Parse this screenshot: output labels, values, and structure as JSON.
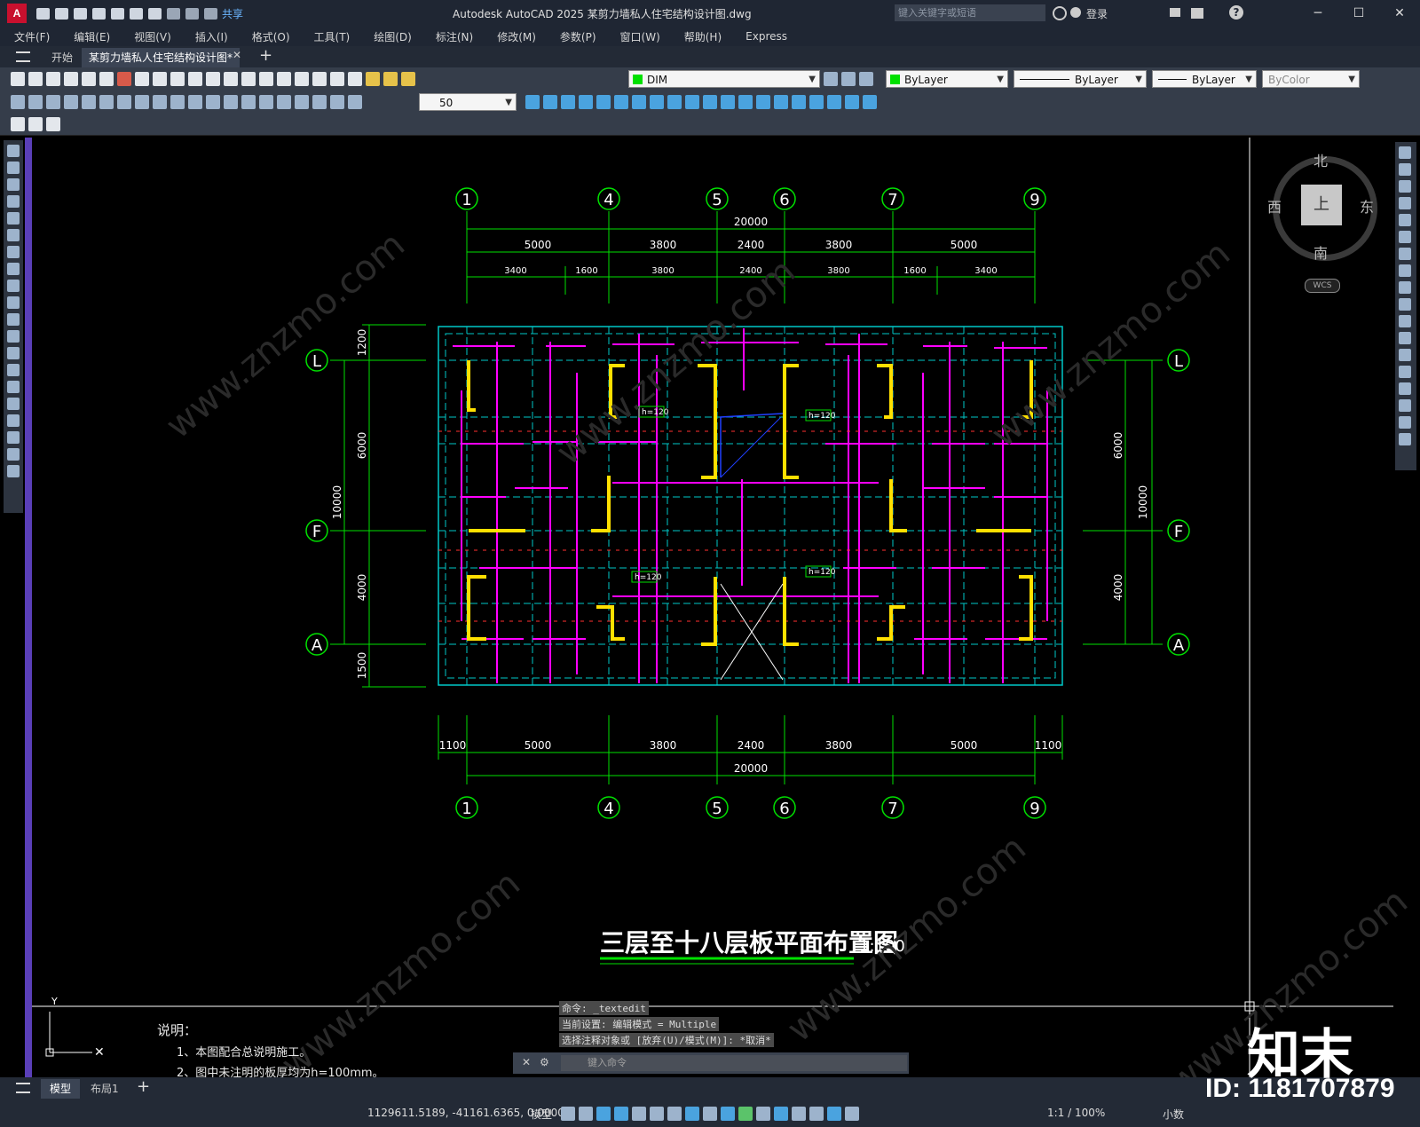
{
  "app": {
    "title": "Autodesk AutoCAD 2025    某剪力墙私人住宅结构设计图.dwg",
    "logo": "A",
    "share_label": "共享",
    "search_placeholder": "键入关键字或短语",
    "login_label": "登录",
    "help_label": "?"
  },
  "menu": [
    "文件(F)",
    "编辑(E)",
    "视图(V)",
    "插入(I)",
    "格式(O)",
    "工具(T)",
    "绘图(D)",
    "标注(N)",
    "修改(M)",
    "参数(P)",
    "窗口(W)",
    "帮助(H)",
    "Express"
  ],
  "tabs": {
    "start": "开始",
    "active": "某剪力墙私人住宅结构设计图*",
    "add": "+"
  },
  "toolbar": {
    "layer": "DIM",
    "color": "ByLayer",
    "linetype": "ByLayer",
    "lineweight": "ByLayer",
    "plotstyle": "ByColor",
    "dim_scale": "50"
  },
  "viewcube": {
    "north": "北",
    "south": "南",
    "east": "东",
    "west": "西",
    "face": "上",
    "wcs": "WCS"
  },
  "drawing": {
    "title": "三层至十八层板平面布置图",
    "scale": "1:100",
    "grid_top": [
      "1",
      "4",
      "5",
      "6",
      "7",
      "9"
    ],
    "grid_side": [
      "L",
      "F",
      "A"
    ],
    "top_total": "20000",
    "top_dims_1": [
      "5000",
      "3800",
      "2400",
      "3800",
      "5000"
    ],
    "top_dims_2": [
      "3400",
      "1600",
      "3800",
      "2400",
      "3800",
      "1600",
      "3400"
    ],
    "bottom_dims": [
      "1100",
      "5000",
      "3800",
      "2400",
      "3800",
      "5000",
      "1100"
    ],
    "bottom_total": "20000",
    "left_dims": [
      "1200",
      "6000",
      "4000",
      "1500"
    ],
    "left_total": "10000",
    "right_dims": [
      "6000",
      "4000"
    ],
    "right_total": "10000",
    "slab_labels": [
      "h=120",
      "h=120",
      "h=120",
      "h=120"
    ]
  },
  "notes": {
    "heading": "说明：",
    "line1": "1、本图配合总说明施工。",
    "line2": "2、图中未注明的板厚均为h=100mm。"
  },
  "command": {
    "history": [
      "命令: _textedit",
      "当前设置: 编辑模式 = Multiple",
      "选择注释对象或 [放弃(U)/模式(M)]: *取消*"
    ],
    "placeholder": "键入命令"
  },
  "layout_tabs": {
    "model": "模型",
    "layout1": "布局1",
    "add": "+"
  },
  "status": {
    "coords": "1129611.5189, -41161.6365, 0.0000",
    "mode": "模型",
    "scale": "1:1 / 100%",
    "units": "小数"
  },
  "brand": {
    "logo": "知末",
    "id": "ID: 1181707879"
  }
}
